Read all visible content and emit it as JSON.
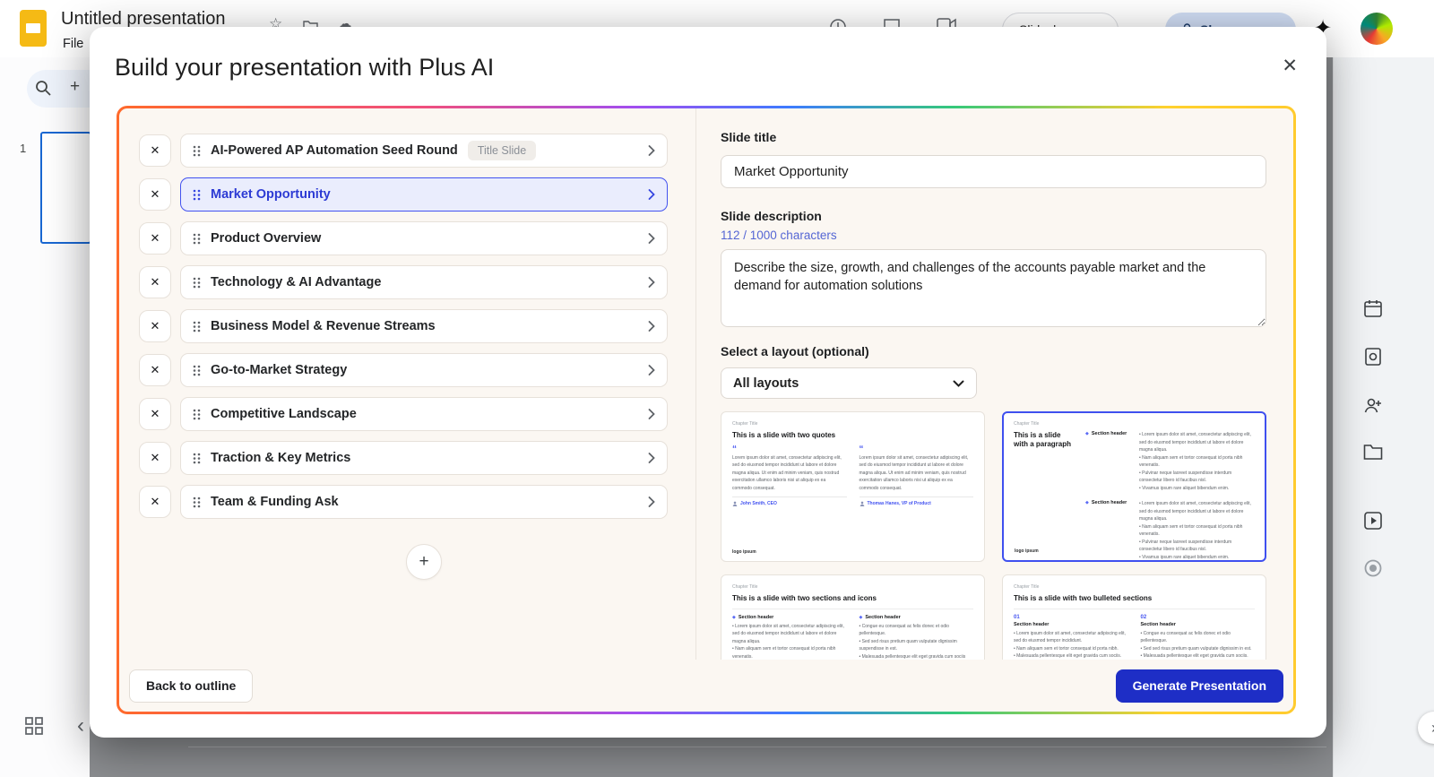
{
  "colors": {
    "accent_blue": "#3f50ef",
    "selected_row_bg": "#eaedfd",
    "selected_row_text": "#2d3bd4",
    "generate_button": "#1e2ec6",
    "content_bg": "#fbf7f2",
    "gradient_left": "#ff6a2b",
    "gradient_right": "#ffcb2e",
    "char_count_blue": "#5566d4",
    "slides_logo_yellow": "#f5ba15",
    "thumb_border_blue": "#1967d2"
  },
  "icons": {
    "close": "✕",
    "remove": "✕",
    "add": "+",
    "sparkle": "✦",
    "star": "☆",
    "cloud": "☁",
    "chevron_left": "‹",
    "chevron_right_small": "›",
    "quote": "“",
    "diamond": "◆"
  },
  "backdrop": {
    "doc_title": "Untitled presentation",
    "menu_file": "File",
    "slide_number": "1",
    "slideshow_label": "Slideshow",
    "share_label": "Share"
  },
  "modal": {
    "title": "Build your presentation with Plus AI"
  },
  "outline": {
    "items": [
      {
        "label": "AI-Powered AP Automation Seed Round",
        "badge": "Title Slide"
      },
      {
        "label": "Market Opportunity"
      },
      {
        "label": "Product Overview"
      },
      {
        "label": "Technology & AI Advantage"
      },
      {
        "label": "Business Model & Revenue Streams"
      },
      {
        "label": "Go-to-Market Strategy"
      },
      {
        "label": "Competitive Landscape"
      },
      {
        "label": "Traction & Key Metrics"
      },
      {
        "label": "Team & Funding Ask"
      }
    ]
  },
  "form": {
    "title_label": "Slide title",
    "title_value": "Market Opportunity",
    "desc_label": "Slide description",
    "char_count": "112 / 1000 characters",
    "desc_value": "Describe the size, growth, and challenges of the accounts payable market and the demand for automation solutions",
    "layout_label": "Select a layout (optional)",
    "layout_value": "All layouts"
  },
  "layouts": {
    "chapter_label": "Chapter Title",
    "quotes": {
      "title": "This is a slide with two quotes",
      "quote_text": "Lorem ipsum dolor sit amet, consectetur adipiscing elit, sed do eiusmod tempor incididunt ut labore et dolore magna aliqua. Ut enim ad minim veniam, quis nostrud exercitation ullamco laboris nisi ut aliquip ex ea commodo consequat.",
      "person1": "John Smith, CEO",
      "person2": "Thomas Hanes, VP of Product",
      "logo": "logo ipsum"
    },
    "paragraph": {
      "title": "This is a slide with a paragraph",
      "section_header": "Section header",
      "bullets": "• Lorem ipsum dolor sit amet, consectetur adipiscing elit, sed do eiusmod tempor incididunt ut labore et dolore magna aliqua.\n• Nam aliquam sem et tortor consequat id porta nibh venenatis.\n• Pulvinar neque laoreet suspendisse interdum consectetur libero id faucibus nisl.\n• Vivamus ipsum rare aliquet bibendum enim.",
      "logo": "logo ipsum"
    },
    "sections": {
      "title": "This is a slide with two sections and icons",
      "section_header": "Section header",
      "col1": "• Lorem ipsum dolor sit amet, consectetur adipiscing elit, sed do eiusmod tempor incididunt ut labore et dolore magna aliqua.\n• Nam aliquam sem et tortor consequat id porta nibh venenatis.",
      "col2": "• Congue eu consequat ac felis donec et odio pellentesque.\n• Sed sed risus pretium quam vulputate dignissim suspendisse in est.\n• Malesuada pellentesque elit eget gravida cum sociis natoque."
    },
    "bulleted": {
      "title": "This is a slide with two bulleted sections",
      "n1": "01",
      "n2": "02",
      "section_header": "Section header",
      "col1": "• Lorem ipsum dolor sit amet, consectetur adipiscing elit, sed do eiusmod tempor incididunt.\n• Nam aliquam sem et tortor consequat id porta nibh.\n• Malesuada pellentesque elit eget gravida cum sociis.",
      "col2": "• Congue eu consequat ac felis donec et odio pellentesque.\n• Sed sed risus pretium quam vulputate dignissim in est.\n• Malesuada pellentesque elit eget gravida cum sociis."
    }
  },
  "footer": {
    "back_label": "Back to outline",
    "generate_label": "Generate Presentation"
  }
}
